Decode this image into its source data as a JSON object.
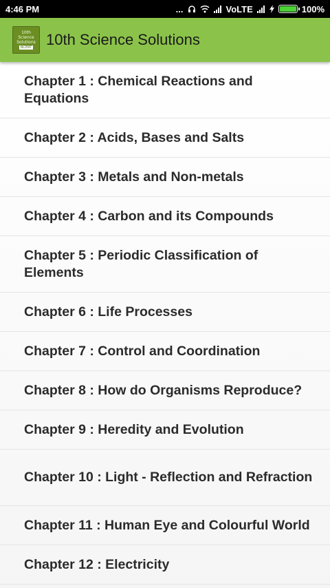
{
  "status_bar": {
    "time": "4:46 PM",
    "dots": "...",
    "network": "VoLTE",
    "battery": "100%",
    "battery_level": 1.0
  },
  "app_bar": {
    "title": "10th Science Solutions",
    "logo": {
      "line1": "10th",
      "line2": "Science",
      "line3": "Solutions",
      "badge": "NCERT"
    }
  },
  "chapters": [
    "Chapter 1 : Chemical Reactions and Equations",
    "Chapter 2 : Acids, Bases and Salts",
    "Chapter 3 : Metals and Non-metals",
    "Chapter 4 : Carbon and its Compounds",
    "Chapter 5 : Periodic Classification of Elements",
    "Chapter 6 : Life Processes",
    "Chapter 7 : Control and Coordination",
    "Chapter 8 : How do Organisms Reproduce?",
    "Chapter 9 : Heredity and Evolution",
    "Chapter 10 : Light - Reflection and Refraction",
    "Chapter 11 : Human Eye and Colourful World",
    "Chapter 12 : Electricity"
  ],
  "colors": {
    "app_bar": "#8bc34a",
    "status_bar": "#000000"
  }
}
